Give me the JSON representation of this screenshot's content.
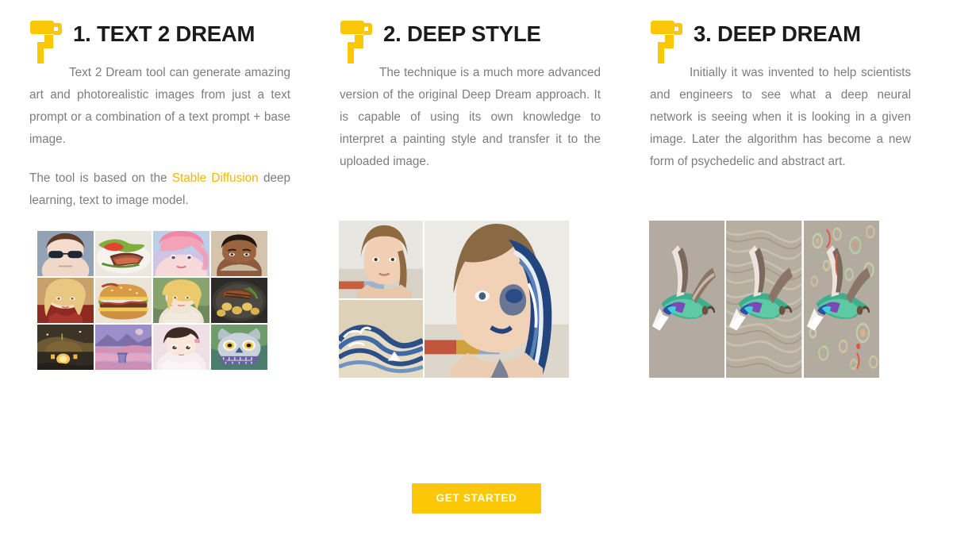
{
  "theme": {
    "accent": "#fbc707",
    "link_color": "#f2b705",
    "heading_color": "#1b1b1b",
    "body_color": "#7d7d7d",
    "page_bg": "#ffffff"
  },
  "columns": [
    {
      "icon": "paint-roller-icon",
      "title": "1. TEXT 2 DREAM",
      "paragraphs": [
        {
          "indented": true,
          "parts": [
            {
              "type": "text",
              "value": "Text 2 Dream tool can generate amazing art and photorealistic images from just a text prompt or a combination of a text prompt + base image."
            }
          ]
        },
        {
          "indented": false,
          "parts": [
            {
              "type": "text",
              "value": "The tool is based on the "
            },
            {
              "type": "link",
              "value": "Stable Diffusion"
            },
            {
              "type": "text",
              "value": " deep learning, text to image model."
            }
          ]
        }
      ],
      "media": {
        "kind": "image-grid",
        "name": "text-2-dream-samples-grid",
        "columns": 4,
        "rows": 3,
        "tiles": [
          "portrait of man with glasses",
          "steak and salad plate",
          "pink-haired fantasy woman",
          "portrait of young man",
          "blonde woman in red",
          "bacon cheeseburger",
          "golden-haired fantasy woman",
          "grilled meat with potatoes",
          "glowing fantasy cottage",
          "pink mountain river landscape",
          "anime style portrait",
          "ornate owl illustration"
        ]
      }
    },
    {
      "icon": "paint-roller-icon",
      "title": "2. DEEP STYLE",
      "paragraphs": [
        {
          "indented": true,
          "parts": [
            {
              "type": "text",
              "value": "The technique is a much more advanced version of the original Deep Dream approach. It is capable of using its own knowledge to interpret a painting style and transfer it to the uploaded image."
            }
          ]
        }
      ],
      "media": {
        "kind": "style-transfer",
        "name": "deep-style-example",
        "panels": [
          "source portrait photo",
          "great wave style reference",
          "stylized portrait result"
        ]
      }
    },
    {
      "icon": "paint-roller-icon",
      "title": "3. DEEP DREAM",
      "paragraphs": [
        {
          "indented": true,
          "parts": [
            {
              "type": "text",
              "value": "Initially it was invented to help scientists and engineers to see what a deep neural network is seeing when it is looking in a given image. Later the algorithm has become a new form of psychedelic and abstract art."
            }
          ]
        }
      ],
      "media": {
        "kind": "triptych",
        "name": "deep-dream-example",
        "panels": [
          "original hummingbird photo",
          "hummingbird with swirl dream pass",
          "hummingbird with deep dream patterns"
        ]
      }
    }
  ],
  "cta": {
    "label": "GET STARTED"
  }
}
